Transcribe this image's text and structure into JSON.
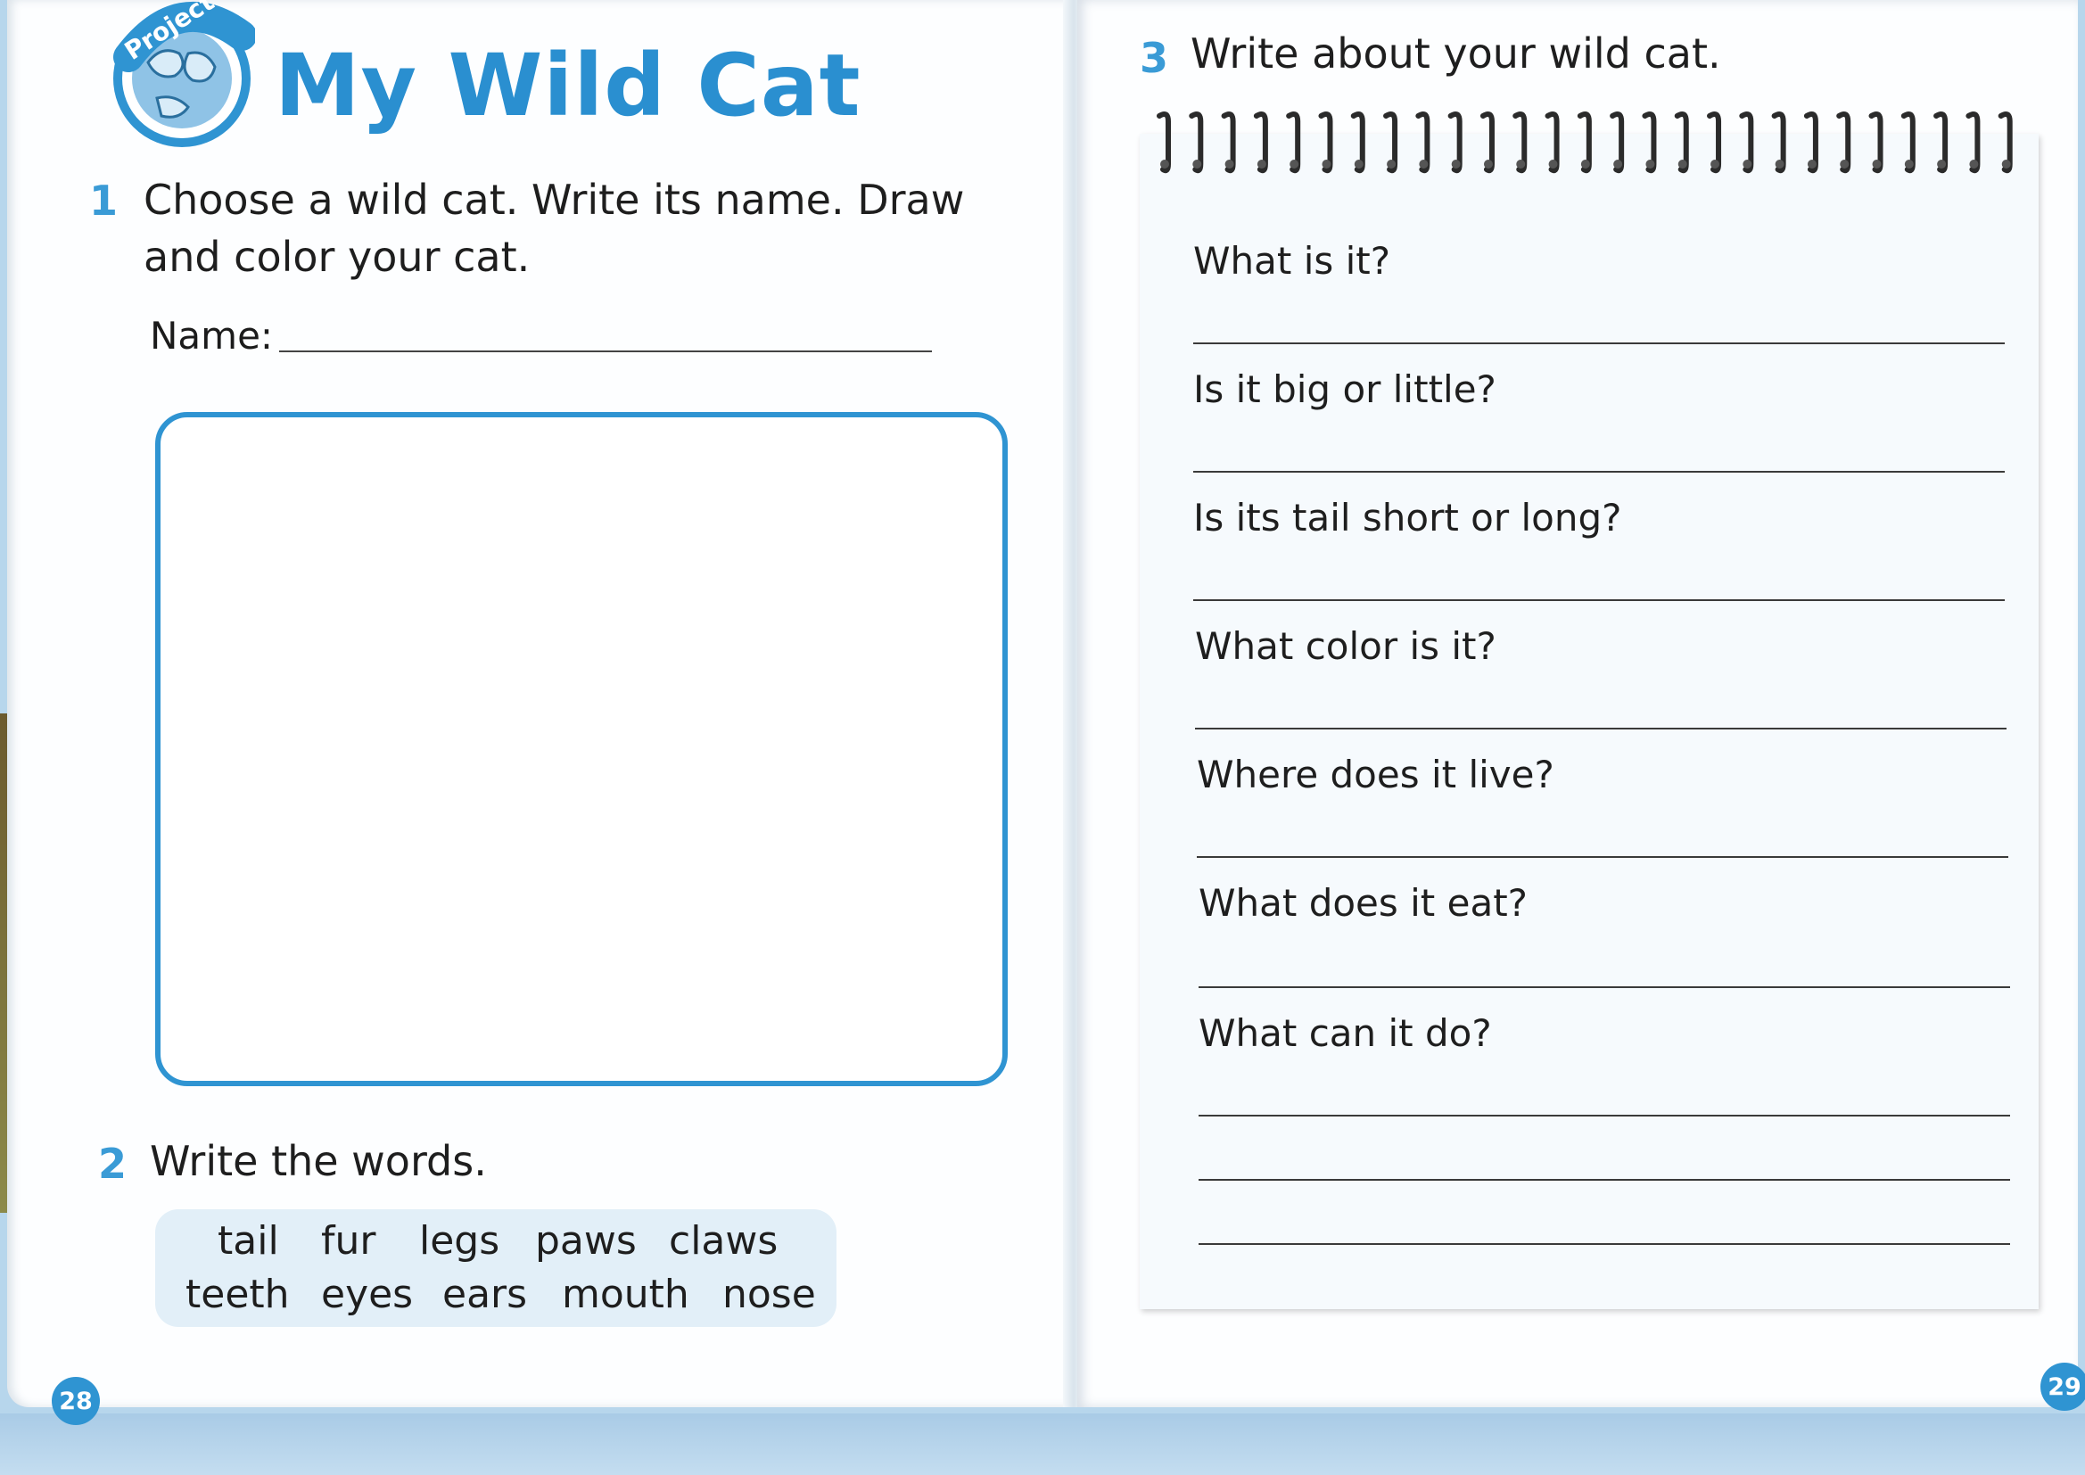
{
  "left_page": {
    "badge_text": "Project",
    "title": "My Wild Cat",
    "q1": {
      "number": "1",
      "line1": "Choose a wild cat. Write its name. Draw",
      "line2": "and color your cat."
    },
    "name_label": "Name:",
    "q2": {
      "number": "2",
      "text": "Write the words."
    },
    "words": [
      "tail",
      "fur",
      "legs",
      "paws",
      "claws",
      "teeth",
      "eyes",
      "ears",
      "mouth",
      "nose"
    ],
    "page_number": "28"
  },
  "right_page": {
    "q3": {
      "number": "3",
      "text": "Write about your wild cat."
    },
    "questions": [
      "What is it?",
      "Is it big or little?",
      "Is its tail short or long?",
      "What color is it?",
      "Where does it live?",
      "What does it eat?",
      "What can it do?"
    ],
    "page_number": "29"
  },
  "colors": {
    "accent_blue": "#2f94d2",
    "word_box_bg": "#e2eff8",
    "scan_background": "#b7d6ec"
  }
}
